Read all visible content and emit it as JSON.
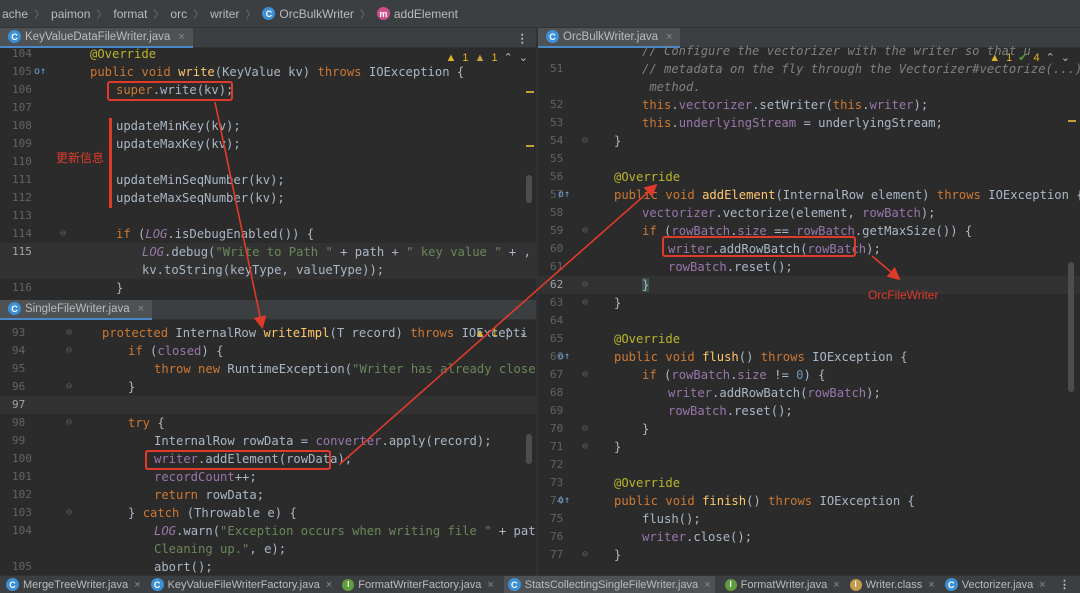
{
  "breadcrumb": [
    "ache",
    "paimon",
    "format",
    "orc",
    "writer",
    "OrcBulkWriter",
    "addElement"
  ],
  "top_left_tab": "KeyValueDataFileWriter.java",
  "bottom_left_tab": "SingleFileWriter.java",
  "right_tab": "OrcBulkWriter.java",
  "top_left_warn": {
    "w1": "1",
    "w2": "1"
  },
  "bottom_left_warn": {
    "w1": "1"
  },
  "right_warn": {
    "w1": "1",
    "ok": "4"
  },
  "annotation_update": "更新信息",
  "annotation_orcfilewriter": "OrcFileWriter",
  "top_left_lines": [
    "104",
    "105",
    "106",
    "107",
    "108",
    "109",
    "110",
    "111",
    "112",
    "113",
    "114",
    "115",
    "",
    "116"
  ],
  "bottom_left_lines": [
    "93",
    "94",
    "95",
    "96",
    "97",
    "98",
    "99",
    "100",
    "101",
    "102",
    "103",
    "104",
    "",
    "105"
  ],
  "right_lines": [
    "",
    "51",
    "",
    "52",
    "53",
    "54",
    "55",
    "56",
    "57",
    "58",
    "59",
    "60",
    "61",
    "62",
    "63",
    "64",
    "65",
    "66",
    "67",
    "68",
    "69",
    "70",
    "71",
    "72",
    "73",
    "74",
    "75",
    "76",
    "77"
  ],
  "bottom_tabs": [
    "MergeTreeWriter.java",
    "KeyValueFileWriterFactory.java",
    "FormatWriterFactory.java",
    "StatsCollectingSingleFileWriter.java",
    "FormatWriter.java",
    "Writer.class",
    "Vectorizer.java"
  ],
  "tab_close": "×",
  "menu_glyph": "⋮"
}
